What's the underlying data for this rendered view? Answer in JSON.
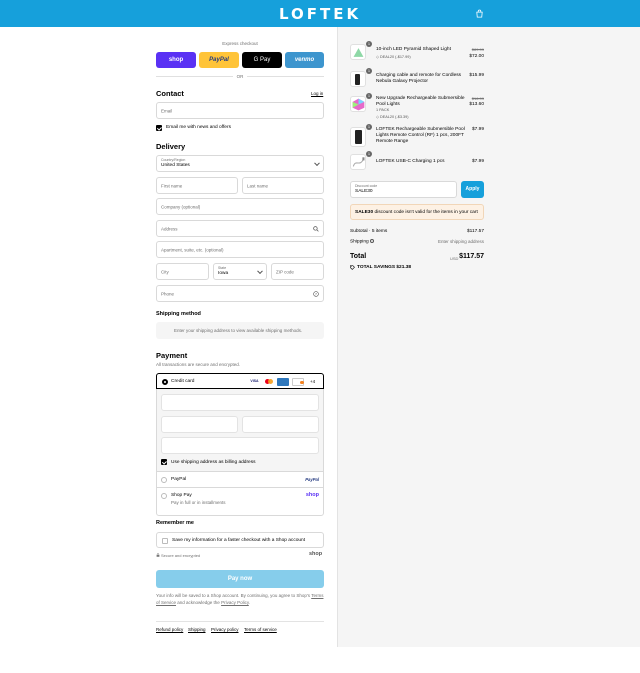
{
  "header": {
    "logo": "LOFTEK"
  },
  "express": {
    "label": "Express checkout",
    "or": "OR",
    "buttons": [
      {
        "label": "shop",
        "color": "#5a31f4"
      },
      {
        "label": "PayPal",
        "color": "#ffc439"
      },
      {
        "label": "G Pay",
        "color": "#000000"
      },
      {
        "label": "venmo",
        "color": "#3d95ce"
      }
    ]
  },
  "contact": {
    "title": "Contact",
    "login": "Log in",
    "email_placeholder": "Email",
    "news_label": "Email me with news and offers"
  },
  "delivery": {
    "title": "Delivery",
    "country_label": "Country/Region",
    "country_value": "United States",
    "first_name": "First name",
    "last_name": "Last name",
    "company": "Company (optional)",
    "address": "Address",
    "apartment": "Apartment, suite, etc. (optional)",
    "city": "City",
    "state_label": "State",
    "state_value": "Iowa",
    "zip": "ZIP code",
    "phone": "Phone"
  },
  "shipping_method": {
    "title": "Shipping method",
    "placeholder": "Enter your shipping address to view available shipping methods."
  },
  "payment": {
    "title": "Payment",
    "subtitle": "All transactions are secure and encrypted.",
    "credit_card": "Credit card",
    "more_cards": "+4",
    "billing_label": "Use shipping address as billing address",
    "paypal": "PayPal",
    "paypal_logo": "PayPal",
    "shop_pay": "Shop Pay",
    "shop_pay_sub": "Pay in full or in installments",
    "shop_logo": "shop"
  },
  "remember": {
    "title": "Remember me",
    "save_label": "Save my information for a faster checkout with a Shop account",
    "secure": "Secure and encrypted",
    "shop_logo": "shop"
  },
  "pay_now": {
    "label": "Pay now",
    "color": "#86cdeb",
    "disclaimer_1": "Your info will be saved to a Shop account. By continuing, you agree to Shop's",
    "terms": "Terms of Service",
    "and_ack": "and acknowledge the",
    "privacy": "Privacy Policy"
  },
  "footer": {
    "links": [
      "Refund policy",
      "Shipping",
      "Privacy policy",
      "Terms of service"
    ]
  },
  "cart": {
    "items": [
      {
        "qty": "1",
        "name": "10-inch LED Pyramid Shaped Light",
        "tag": "DEAL20 (-$17.99)",
        "old_price": "$89.99",
        "price": "$72.00"
      },
      {
        "qty": "1",
        "name": "Charging cable and remote for Cordless Nebula Galaxy Projector",
        "tag": "",
        "old_price": "",
        "price": "$15.99"
      },
      {
        "qty": "1",
        "name": "New Upgrade Rechargeable Submersible Pool Lights",
        "variant": "1 PACK",
        "tag": "DEAL20 (-$3.39)",
        "old_price": "$16.99",
        "price": "$13.60"
      },
      {
        "qty": "1",
        "name": "LOFTEK Rechargeable Submersible Pool Lights Remote Control (RF) 1 pcs, 200FT Remote Range",
        "tag": "",
        "old_price": "",
        "price": "$7.99"
      },
      {
        "qty": "1",
        "name": "LOFTEK USB-C Charging 1 pcs",
        "tag": "",
        "old_price": "",
        "price": "$7.99"
      }
    ],
    "discount_label": "Discount code",
    "discount_value": "SALE30",
    "apply": "Apply",
    "apply_color": "#16a0db",
    "notice_code": "SALE30",
    "notice_text": "discount code isn't valid for the items in your cart",
    "subtotal_label": "Subtotal · 5 items",
    "subtotal": "$117.57",
    "shipping_label": "Shipping",
    "shipping_value": "Enter shipping address",
    "total_label": "Total",
    "currency": "USD",
    "total": "$117.57",
    "savings_label": "TOTAL SAVINGS",
    "savings": "$21.38"
  }
}
